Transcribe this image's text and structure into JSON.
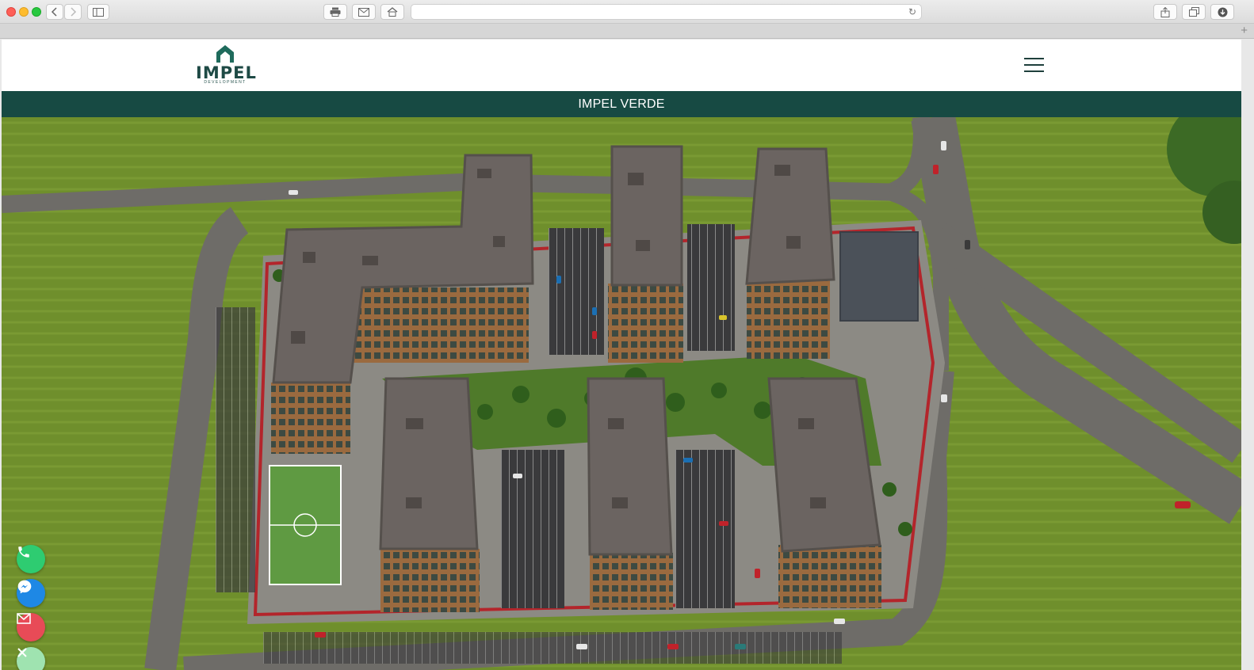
{
  "browser": {
    "address_value": "",
    "icons": [
      "back-icon",
      "forward-icon",
      "sidebar-icon",
      "print-icon",
      "mail-icon",
      "home-icon",
      "reload-icon",
      "share-icon",
      "tabs-icon",
      "download-icon",
      "new-tab-icon"
    ]
  },
  "header": {
    "logo_word": "IMPEL",
    "logo_sub": "DEVELOPMENT",
    "menu_icon": "hamburger-menu-icon"
  },
  "title_bar": {
    "title": "IMPEL VERDE"
  },
  "colors": {
    "brand_green": "#174a43",
    "phone": "#2ecc71",
    "messenger": "#1e88e5",
    "email": "#e84b57",
    "close": "#9fe3b0"
  },
  "contact_buttons": [
    {
      "name": "phone-icon"
    },
    {
      "name": "messenger-icon"
    },
    {
      "name": "email-icon"
    },
    {
      "name": "close-icon"
    }
  ]
}
